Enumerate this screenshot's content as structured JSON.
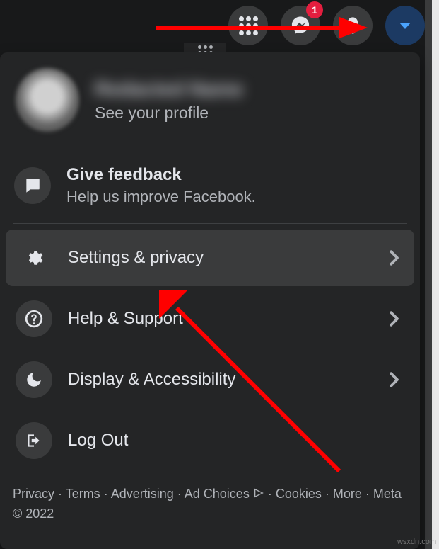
{
  "topbar": {
    "messenger_badge": "1"
  },
  "profile": {
    "name": "Redacted Name",
    "subtitle": "See your profile"
  },
  "feedback": {
    "title": "Give feedback",
    "subtitle": "Help us improve Facebook."
  },
  "menu": {
    "settings": "Settings & privacy",
    "help": "Help & Support",
    "display": "Display & Accessibility",
    "logout": "Log Out"
  },
  "footer": {
    "privacy": "Privacy",
    "terms": "Terms",
    "advertising": "Advertising",
    "adchoices": "Ad Choices",
    "cookies": "Cookies",
    "more": "More",
    "meta": "Meta © 2022"
  },
  "watermark": "wsxdn.com"
}
